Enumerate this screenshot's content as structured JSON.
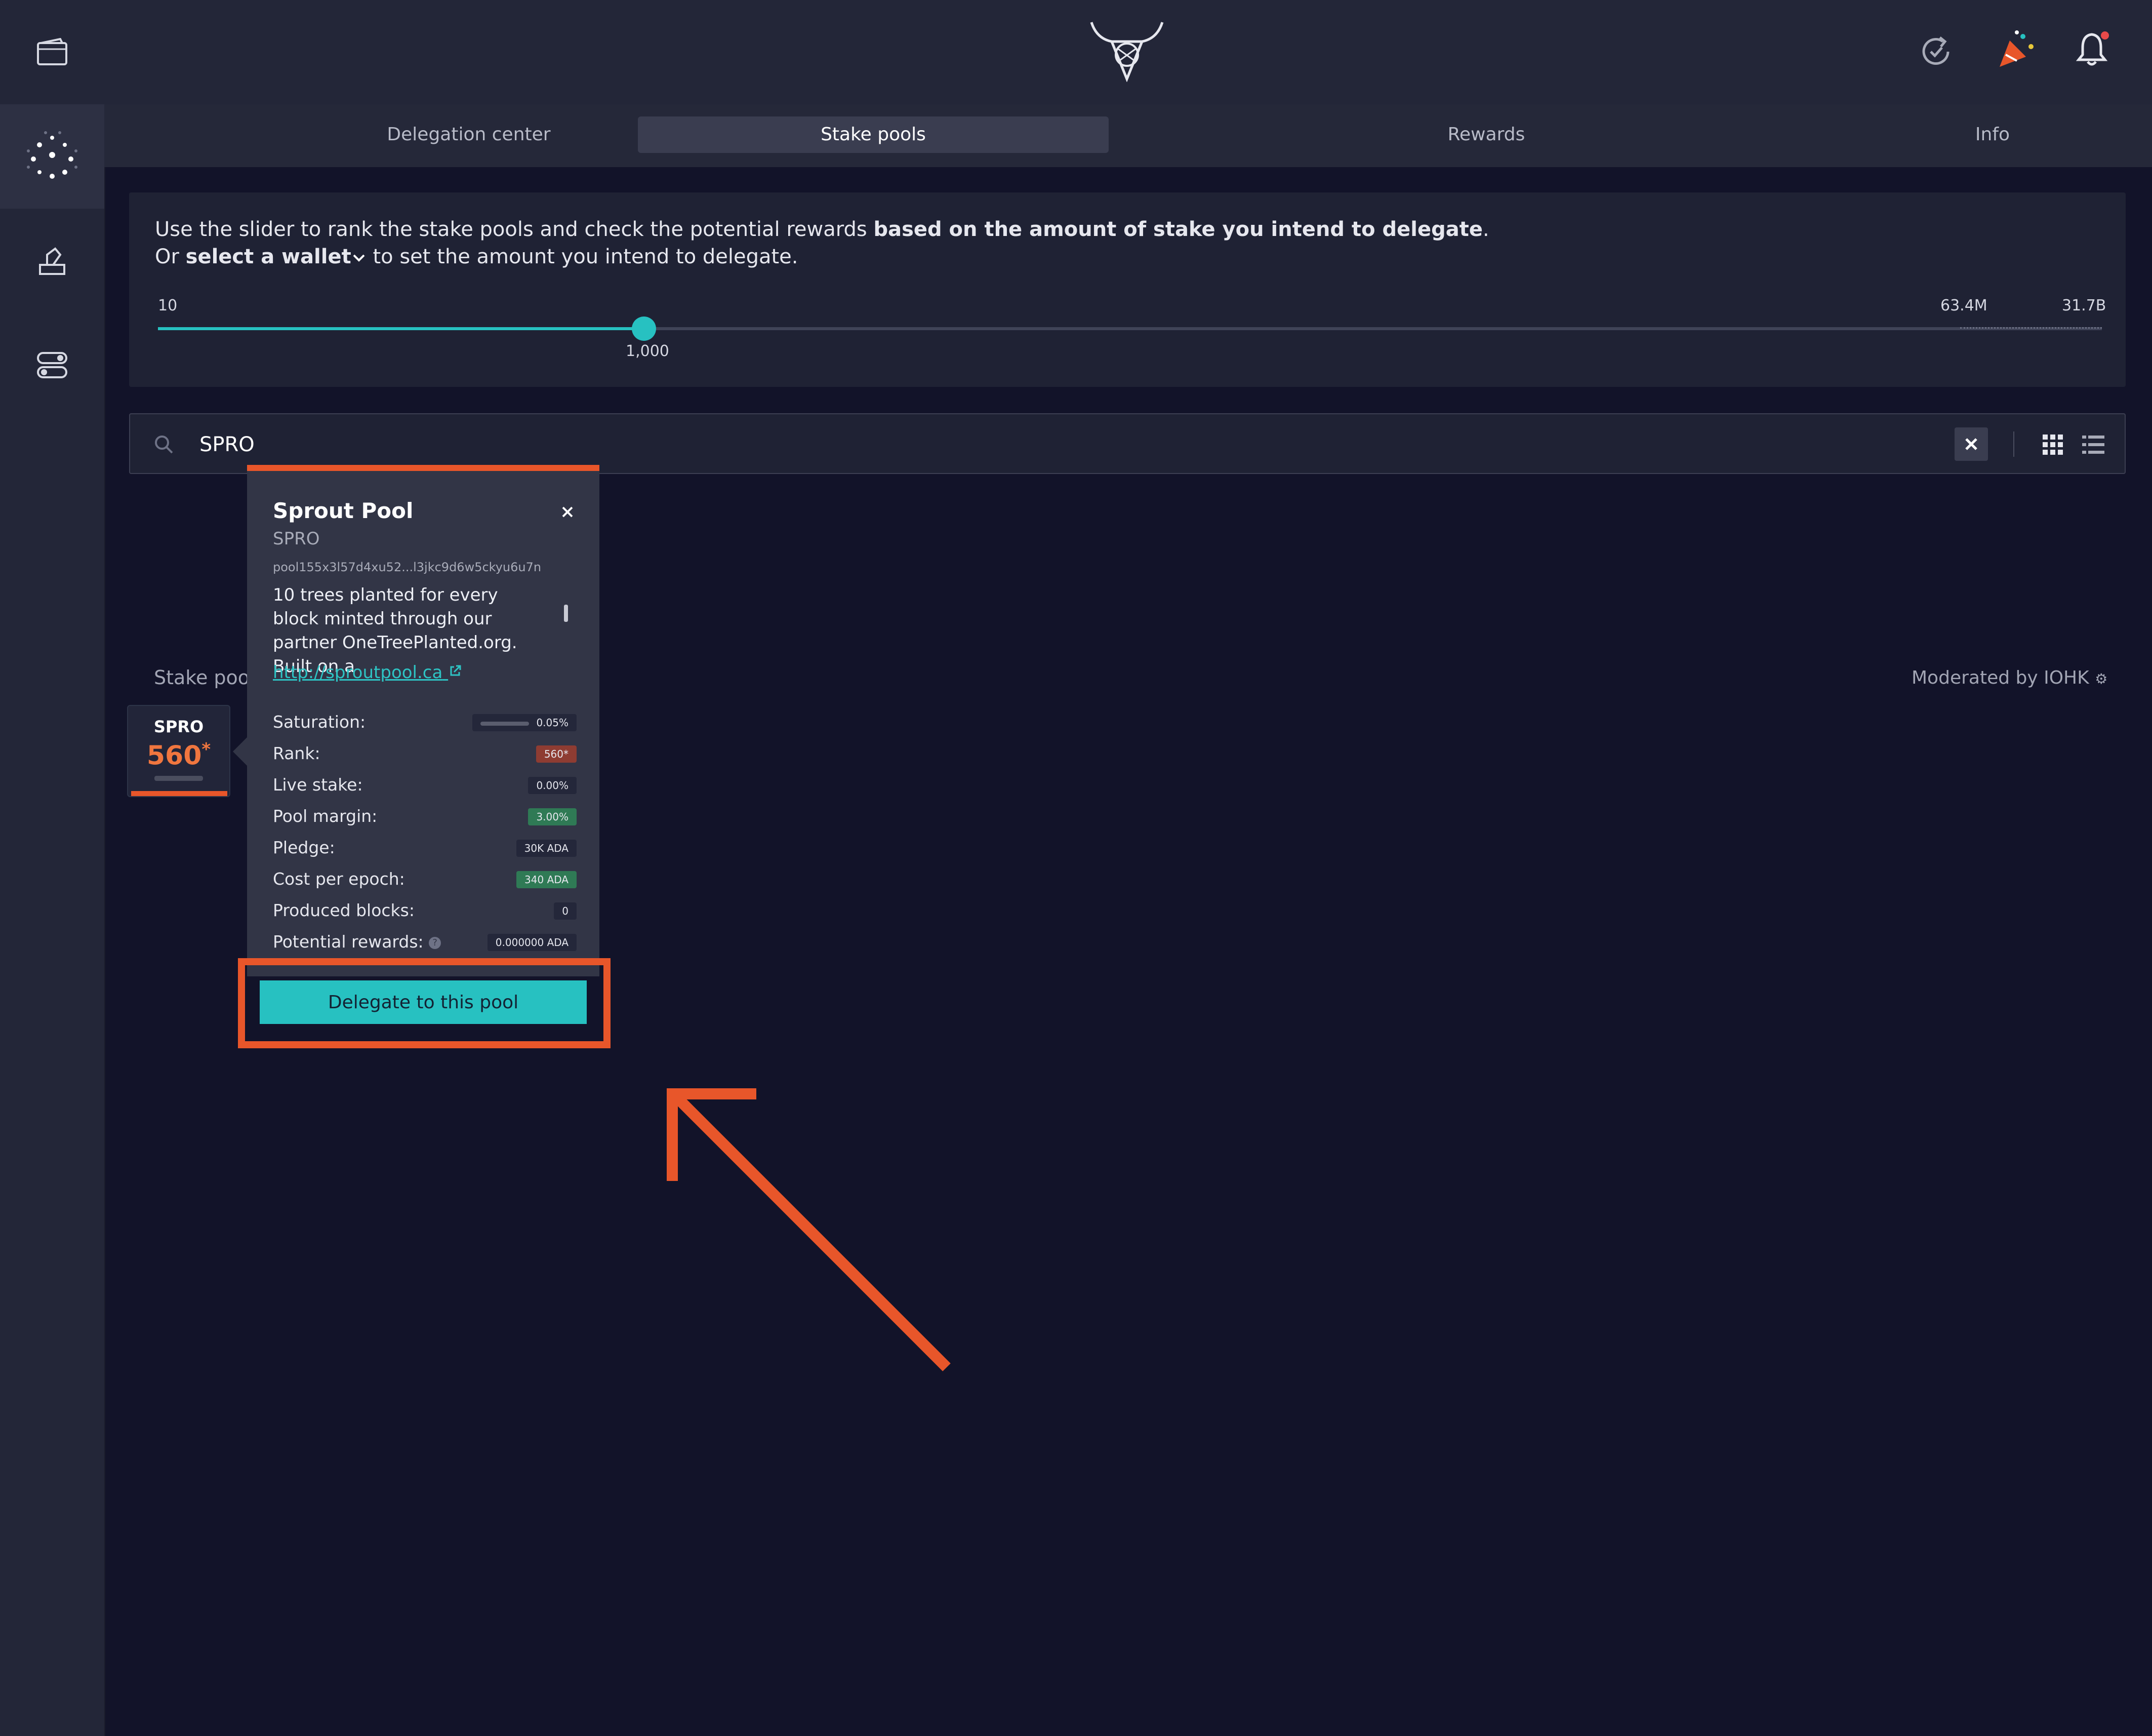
{
  "tabs": [
    "Delegation center",
    "Stake pools",
    "Rewards",
    "Info"
  ],
  "hint": {
    "line1_part1": "Use the slider to rank the stake pools and check the potential rewards ",
    "line1_bold": "based on the amount of stake you intend to delegate",
    "line1_end": ".",
    "line2_part1": "Or ",
    "line2_bold": "select a wallet",
    "line2_end": " to set the amount you intend to delegate."
  },
  "slider": {
    "min_label": "10",
    "mid_label": "63.4M",
    "max_label": "31.7B",
    "value_label": "1,000",
    "value_fraction": 0.25
  },
  "search": {
    "value": "SPRO"
  },
  "section": {
    "title": "Stake poo",
    "moderated": "Moderated by IOHK"
  },
  "card": {
    "ticker": "SPRO",
    "rank": "560",
    "rank_suffix": "*"
  },
  "popover": {
    "name": "Sprout Pool",
    "ticker": "SPRO",
    "pool_id": "pool155x3l57d4xu52...l3jkc9d6w5ckyu6u7n",
    "description": "10 trees planted for every block minted through our partner OneTreePlanted.org. Built on a",
    "link": "http://sproutpool.ca",
    "stats": [
      {
        "label": "Saturation:",
        "value": "0.05%",
        "style": "plain"
      },
      {
        "label": "Rank:",
        "value": "560*",
        "style": "red"
      },
      {
        "label": "Live stake:",
        "value": "0.00%",
        "style": "plain"
      },
      {
        "label": "Pool margin:",
        "value": "3.00%",
        "style": "green"
      },
      {
        "label": "Pledge:",
        "value": "30K ADA",
        "style": "plain"
      },
      {
        "label": "Cost per epoch:",
        "value": "340 ADA",
        "style": "green"
      },
      {
        "label": "Produced blocks:",
        "value": "0",
        "style": "plain"
      },
      {
        "label": "Potential rewards:",
        "value": "0.000000 ADA",
        "style": "plain"
      }
    ],
    "delegate_button": "Delegate to this pool"
  },
  "colors": {
    "accent": "#27c1c1",
    "highlight": "#e8562a",
    "rank": "#f0763f"
  }
}
